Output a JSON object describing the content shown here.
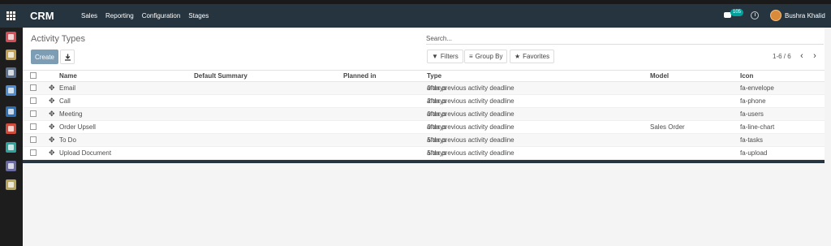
{
  "navbar": {
    "brand": "CRM",
    "menu": [
      "Sales",
      "Reporting",
      "Configuration",
      "Stages"
    ],
    "message_count": "105",
    "user_name": "Bushra Khalid"
  },
  "sidebar": {
    "apps": [
      {
        "name": "discuss-app-icon",
        "color": "#d64d55"
      },
      {
        "name": "calendar-app-icon",
        "color": "#c2a24e"
      },
      {
        "name": "contacts-app-icon",
        "color": "#5b6f8f"
      },
      {
        "name": "crm-app-icon",
        "color": "#4d8ccf"
      },
      {
        "name": "apps-app-icon",
        "color": "#2d6fb5"
      },
      {
        "name": "timesheet-app-icon",
        "color": "#d14b3d"
      },
      {
        "name": "employees-app-icon",
        "color": "#2ea39d"
      },
      {
        "name": "search-app-icon",
        "color": "#6a6a9e"
      },
      {
        "name": "settings-app-icon",
        "color": "#b9a55a"
      }
    ]
  },
  "control_panel": {
    "title": "Activity Types",
    "create_label": "Create",
    "search_placeholder": "Search...",
    "filters_label": "Filters",
    "groupby_label": "Group By",
    "favorites_label": "Favorites",
    "pager_value": "1-6 / 6"
  },
  "table": {
    "columns": [
      "Name",
      "Default Summary",
      "Planned in",
      "Type",
      "Model",
      "Icon"
    ],
    "rows": [
      {
        "name": "Email",
        "summary": "",
        "planned": "0 days",
        "type": "after previous activity deadline",
        "model": "",
        "icon": "fa-envelope"
      },
      {
        "name": "Call",
        "summary": "",
        "planned": "2 days",
        "type": "after previous activity deadline",
        "model": "",
        "icon": "fa-phone"
      },
      {
        "name": "Meeting",
        "summary": "",
        "planned": "0 days",
        "type": "after previous activity deadline",
        "model": "",
        "icon": "fa-users"
      },
      {
        "name": "Order Upsell",
        "summary": "",
        "planned": "0 days",
        "type": "after previous activity deadline",
        "model": "Sales Order",
        "icon": "fa-line-chart"
      },
      {
        "name": "To Do",
        "summary": "",
        "planned": "5 days",
        "type": "after previous activity deadline",
        "model": "",
        "icon": "fa-tasks"
      },
      {
        "name": "Upload Document",
        "summary": "",
        "planned": "5 days",
        "type": "after previous activity deadline",
        "model": "",
        "icon": "fa-upload"
      }
    ]
  },
  "colors": {
    "navbar": "#26343f",
    "primary_button": "#7c9db4",
    "badge": "#00a09d"
  }
}
